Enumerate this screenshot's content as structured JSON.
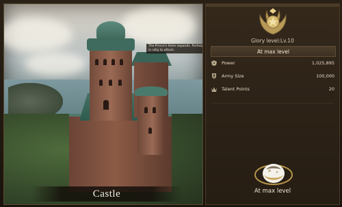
{
  "scene": {
    "building_name": "Castle",
    "tooltip_text": "The Prince's fame expands. Participate in rally to attack."
  },
  "info": {
    "level_label": "Glory level:Lv.10",
    "max_banner_label": "At max level",
    "stats": [
      {
        "label": "Power",
        "value": "1,025,895",
        "icon": "power-icon"
      },
      {
        "label": "Army Size",
        "value": "100,000",
        "icon": "army-icon"
      },
      {
        "label": "Talent Points",
        "value": "20",
        "icon": "talent-icon"
      }
    ],
    "upgrade_label": "At max level"
  },
  "colors": {
    "panel_bg": "#2b2118",
    "gold": "#c9a55a",
    "text_light": "#f1e7d3"
  }
}
